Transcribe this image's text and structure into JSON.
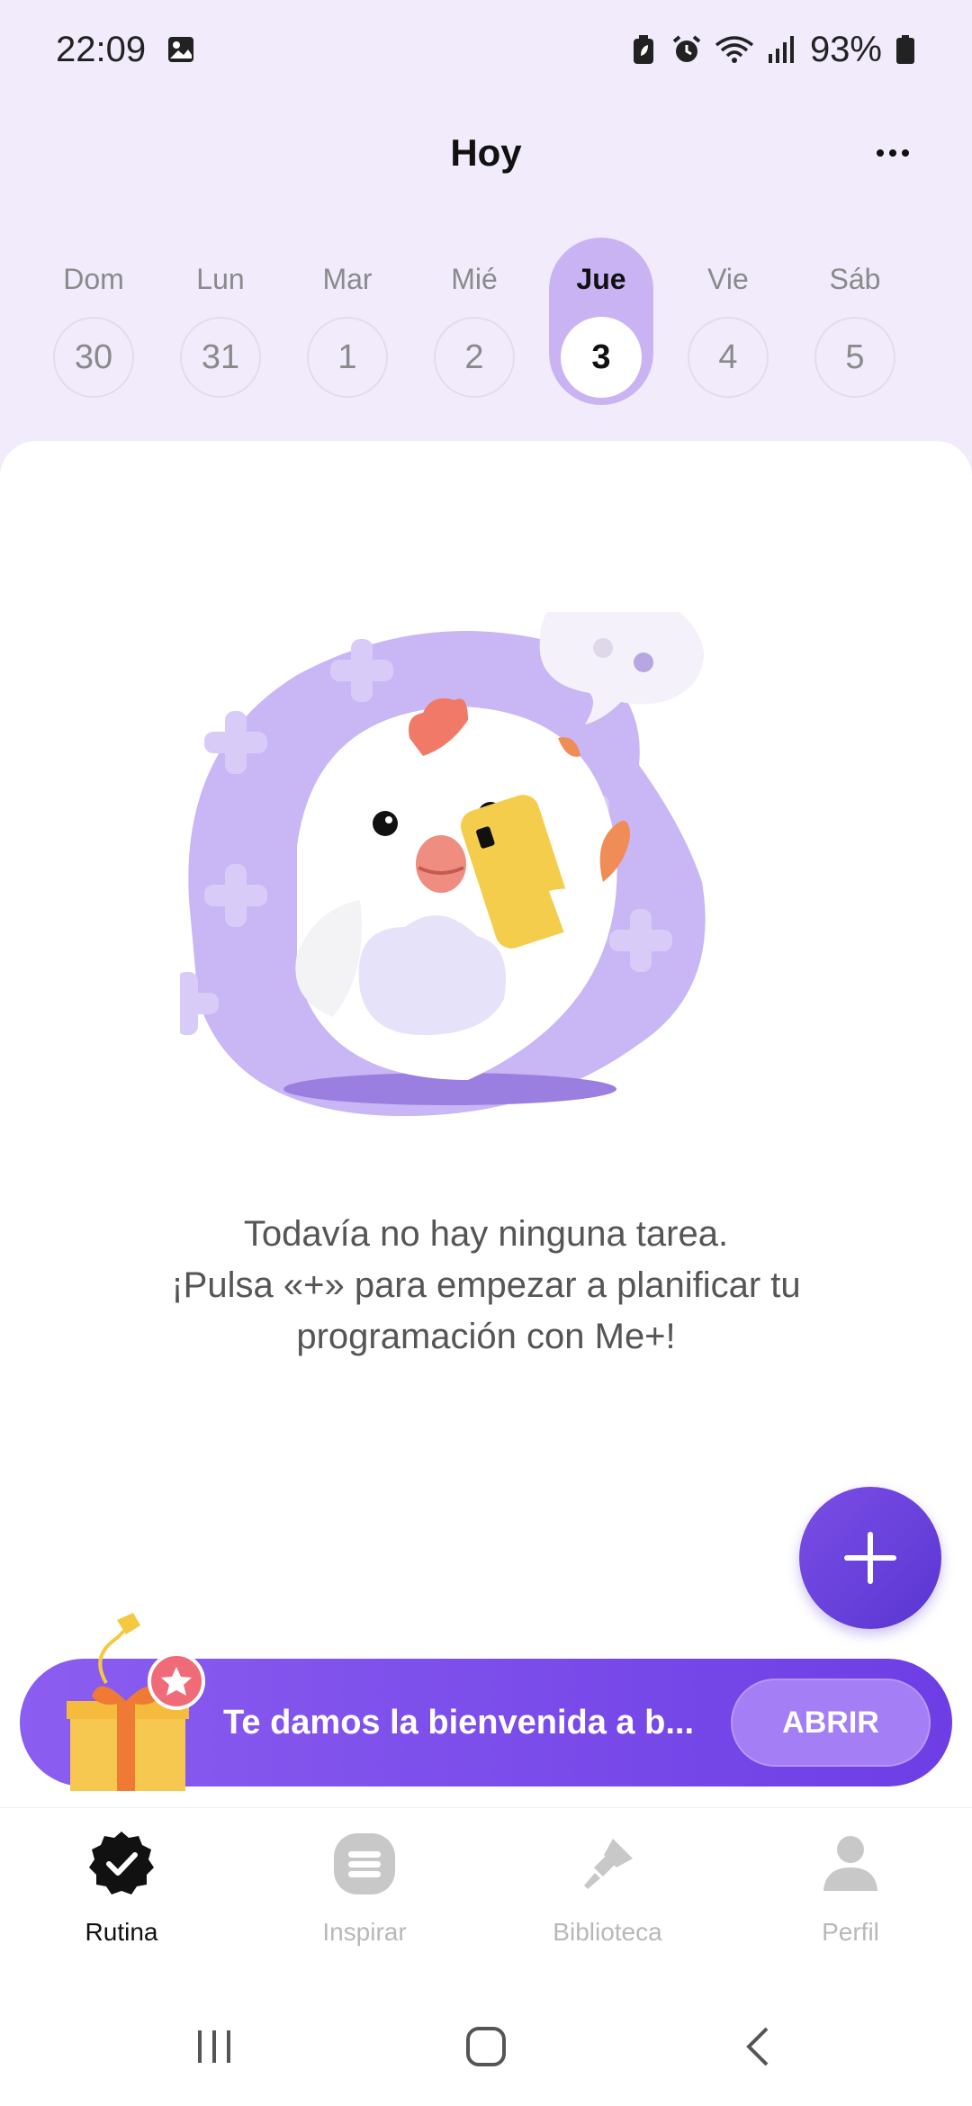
{
  "status_bar": {
    "time": "22:09",
    "battery": "93%",
    "icons": [
      "image-icon",
      "battery-saver-icon",
      "alarm-icon",
      "wifi-icon",
      "signal-icon",
      "battery-icon"
    ]
  },
  "header": {
    "title": "Hoy",
    "more_icon": "more-horizontal-icon"
  },
  "week": {
    "days": [
      {
        "name": "Dom",
        "num": "30"
      },
      {
        "name": "Lun",
        "num": "31"
      },
      {
        "name": "Mar",
        "num": "1"
      },
      {
        "name": "Mié",
        "num": "2"
      },
      {
        "name": "Jue",
        "num": "3"
      },
      {
        "name": "Vie",
        "num": "4"
      },
      {
        "name": "Sáb",
        "num": "5"
      }
    ],
    "selected_day": "Jue"
  },
  "empty_state": {
    "line1": "Todavía no hay ninguna tarea.",
    "line2": "¡Pulsa «+» para empezar a planificar tu",
    "line3": "programación con Me+!"
  },
  "fab": {
    "icon": "plus-icon"
  },
  "promo": {
    "text": "Te damos la bienvenida a b...",
    "button": "ABRIR",
    "icon": "gift-icon"
  },
  "bottom_nav": {
    "items": [
      {
        "label": "Rutina",
        "icon": "check-badge-icon",
        "active": true
      },
      {
        "label": "Inspirar",
        "icon": "list-icon",
        "active": false
      },
      {
        "label": "Biblioteca",
        "icon": "brush-icon",
        "active": false
      },
      {
        "label": "Perfil",
        "icon": "person-icon",
        "active": false
      }
    ]
  },
  "colors": {
    "background": "#f1ebfc",
    "accent": "#6d3ee4",
    "selected_day": "#c9b3f2",
    "illustration": "#c7b3f3"
  }
}
